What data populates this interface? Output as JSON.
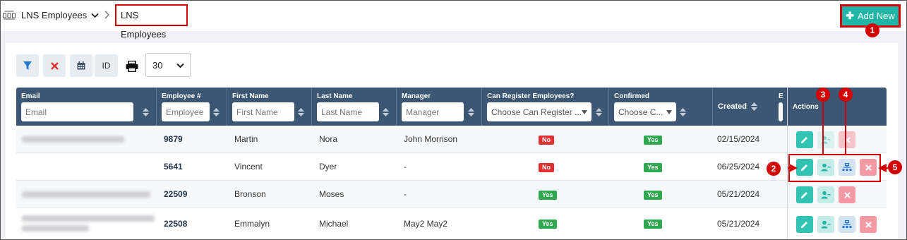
{
  "header": {
    "app_name": "LNS Employees",
    "breadcrumb_current": "LNS Employees",
    "add_new_label": "Add New"
  },
  "toolbar": {
    "id_label": "ID",
    "page_size": "30"
  },
  "columns": {
    "email": {
      "label": "Email",
      "placeholder": "Email"
    },
    "employee_num": {
      "label": "Employee #",
      "placeholder": "Employee"
    },
    "first_name": {
      "label": "First Name",
      "placeholder": "First Name"
    },
    "last_name": {
      "label": "Last Name",
      "placeholder": "Last Name"
    },
    "manager": {
      "label": "Manager",
      "placeholder": "Manager"
    },
    "can_register": {
      "label": "Can Register Employees?",
      "placeholder": "Choose Can Register ..."
    },
    "confirmed": {
      "label": "Confirmed",
      "placeholder": "Choose C..."
    },
    "created": {
      "label": "Created"
    },
    "e_partial": {
      "label": "E"
    },
    "actions": {
      "label": "Actions"
    }
  },
  "rows": [
    {
      "employee_num": "9879",
      "first_name": "Martin",
      "last_name": "Nora",
      "manager": "John Morrison",
      "can_register": "No",
      "confirmed": "Yes",
      "created": "02/15/2024"
    },
    {
      "employee_num": "5641",
      "first_name": "Vincent",
      "last_name": "Dyer",
      "manager": "-",
      "can_register": "No",
      "confirmed": "Yes",
      "created": "06/25/2024"
    },
    {
      "employee_num": "22509",
      "first_name": "Bronson",
      "last_name": "Moses",
      "manager": "-",
      "can_register": "Yes",
      "confirmed": "Yes",
      "created": "05/21/2024"
    },
    {
      "employee_num": "22508",
      "first_name": "Emmalyn",
      "last_name": "Michael",
      "manager": "May2 May2",
      "can_register": "Yes",
      "confirmed": "Yes",
      "created": "05/21/2024"
    }
  ],
  "markers": [
    "1",
    "2",
    "3",
    "4",
    "5"
  ],
  "colors": {
    "accent": "#1fb5a7",
    "header_bg": "#3c5674",
    "annotation_red": "#d40000",
    "yes": "#2fa84f",
    "no": "#e0302f"
  },
  "icons": [
    "org-chart-icon",
    "chevron-down-icon",
    "chevron-right-icon",
    "plus-icon",
    "filter-icon",
    "clear-icon",
    "calendar-icon",
    "print-icon",
    "sort-icon",
    "pencil-icon",
    "user-add-icon",
    "org-tree-icon",
    "delete-icon"
  ]
}
